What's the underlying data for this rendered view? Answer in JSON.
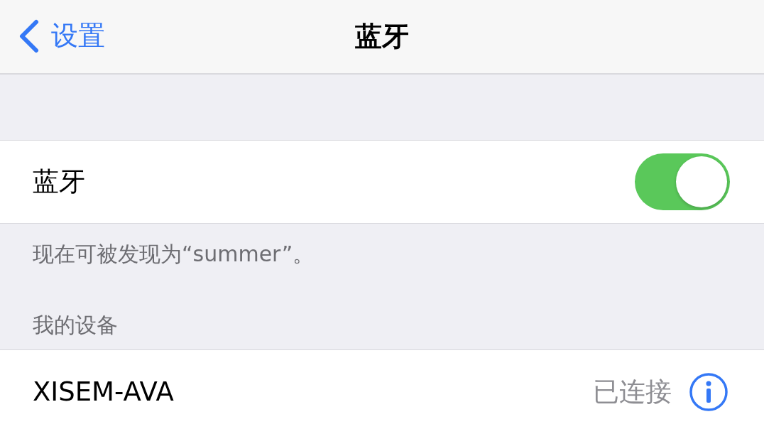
{
  "nav": {
    "back_label": "设置",
    "title": "蓝牙"
  },
  "bluetooth": {
    "label": "蓝牙",
    "on": true
  },
  "discoverable_note": "现在可被发现为“summer”。",
  "section_header": "我的设备",
  "devices": [
    {
      "name": "XISEM-AVA",
      "status": "已连接"
    }
  ]
}
